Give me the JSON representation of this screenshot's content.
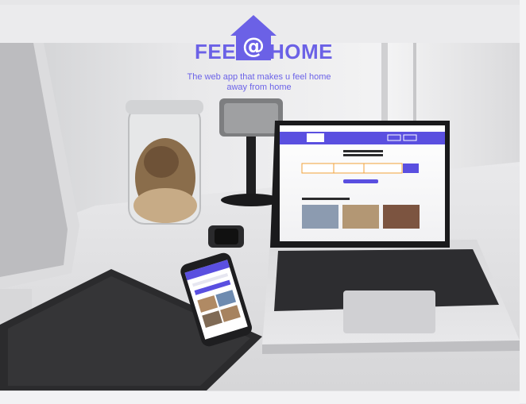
{
  "brand": {
    "left_text": "FEEL",
    "at_symbol": "@",
    "right_text": "HOME",
    "color": "#6b61e6"
  },
  "tagline": {
    "line1": "The web app that makes u feel home",
    "line2": "away from home"
  },
  "mockup": {
    "laptop_nav": {
      "register": "Register",
      "signin": "Sign in"
    },
    "laptop_heading_1": "ON PLACES YOU CAN GO",
    "laptop_heading_2": "MEMORIES & CLOSE HOME",
    "laptop_search": {
      "where_placeholder": "Where are you going",
      "checkin_placeholder": "Check in - check out",
      "guests_placeholder": "1 adults 0 children 0 rooms",
      "search_button": "Search"
    },
    "laptop_section_title": "PLACES RECOMENDATIONS",
    "accent": "#5a4fe0"
  }
}
